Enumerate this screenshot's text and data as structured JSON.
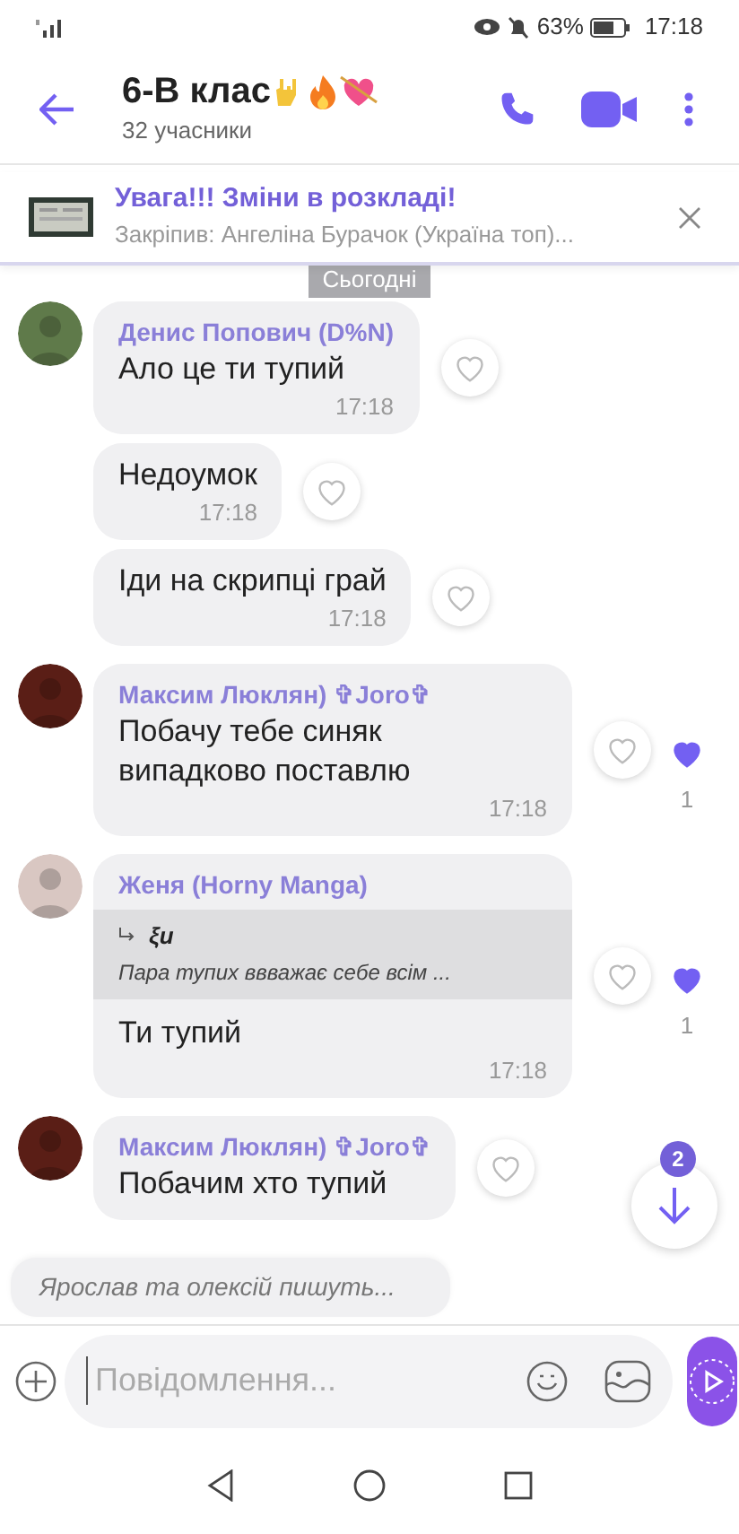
{
  "status_bar": {
    "battery": "63%",
    "time": "17:18"
  },
  "header": {
    "title": "6-В клас",
    "subtitle": "32 учасники"
  },
  "pinned": {
    "title": "Увага!!! Зміни в розкладі!",
    "subtitle": "Закріпив: Ангеліна Бурачок (Україна топ)..."
  },
  "date_chip": "Сьогодні",
  "groups": [
    {
      "sender": "Денис Попович (D%N)",
      "messages": [
        {
          "text": "Ало це ти тупий",
          "time": "17:18",
          "reacted": false
        },
        {
          "text": "Недоумок",
          "time": "17:18",
          "reacted": false
        },
        {
          "text": "Іди на скрипці грай",
          "time": "17:18",
          "reacted": false
        }
      ]
    },
    {
      "sender": "Максим Люклян) ✞Joro✞",
      "messages": [
        {
          "text": "Побачу тебе синяк випадково поставлю",
          "time": "17:18",
          "reacted": true,
          "count": "1"
        }
      ]
    },
    {
      "sender": "Женя (Horny Manga)",
      "messages": [
        {
          "quote": {
            "author": "ξu",
            "text": "Пара тупих ввважає себе всім ..."
          },
          "text": "Ти тупий",
          "time": "17:18",
          "reacted": true,
          "count": "1"
        }
      ]
    },
    {
      "sender": "Максим Люклян) ✞Joro✞",
      "messages": [
        {
          "text": "Побачим хто тупий",
          "reacted": false,
          "cut": true
        }
      ]
    }
  ],
  "typing": "Ярослав та олексій пишуть...",
  "scroll_badge": "2",
  "composer": {
    "placeholder": "Повідомлення..."
  }
}
